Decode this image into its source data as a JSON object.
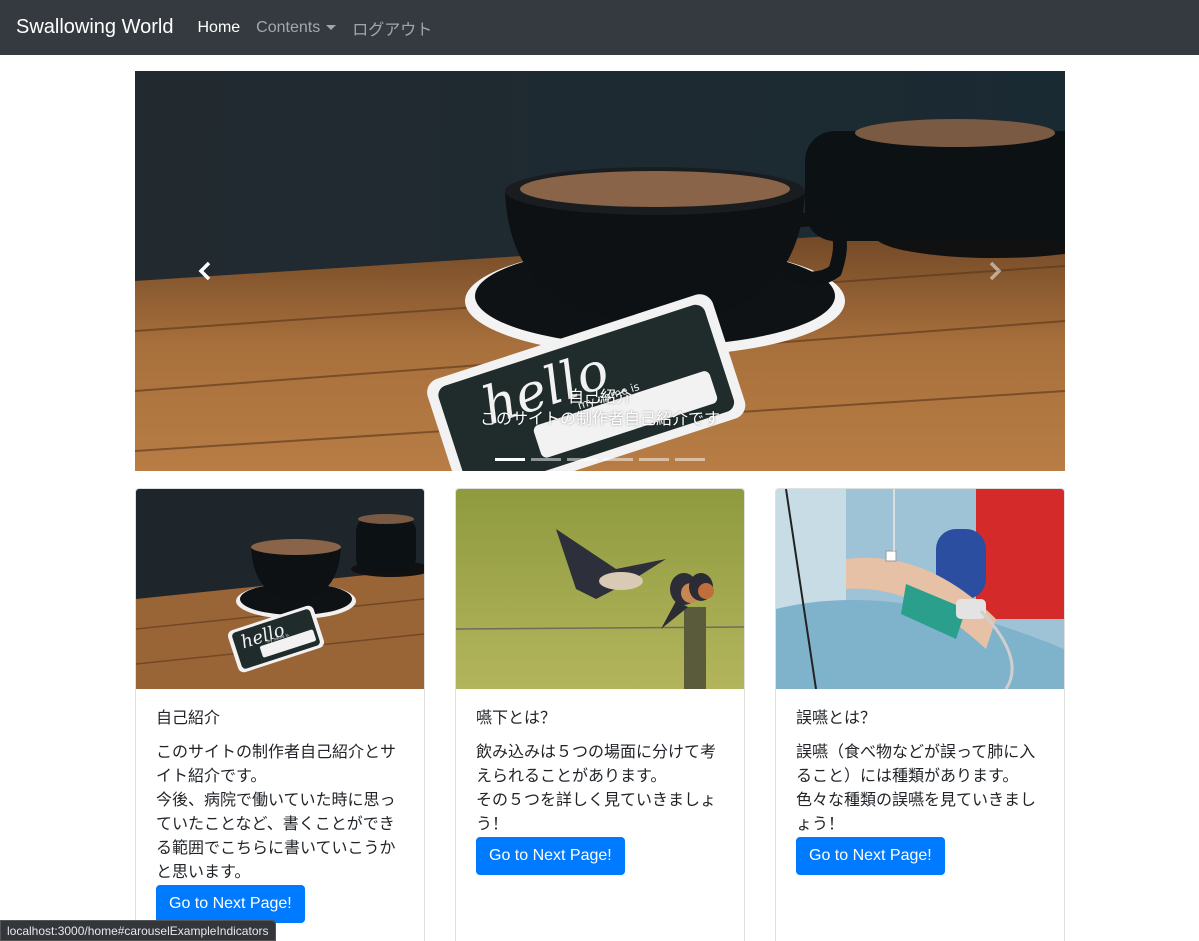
{
  "navbar": {
    "brand": "Swallowing World",
    "items": [
      {
        "label": "Home"
      },
      {
        "label": "Contents"
      },
      {
        "label": "ログアウト"
      }
    ]
  },
  "carousel": {
    "caption_title": "自己紹介",
    "caption_text": "このサイトの制作者自己紹介です",
    "indicator_count": 6,
    "active_index": 0,
    "sticker_text": "hello",
    "sticker_sub": "my name is"
  },
  "cards": [
    {
      "title": "自己紹介",
      "lines": [
        "このサイトの制作者自己紹介とサ",
        "イト紹介です。",
        "今後、病院で働いていた時に思っ",
        "ていたことなど、書くことができ",
        "る範囲でこちらに書いていこうか",
        "と思います。"
      ],
      "button": "Go to Next Page!",
      "sticker_text": "hello",
      "sticker_sub": "my name is"
    },
    {
      "title": "嚥下とは？",
      "lines": [
        "飲み込みは５つの場面に分けて考",
        "えられることがあります。",
        "その５つを詳しく見ていきましょ",
        "う！"
      ],
      "button": "Go to Next Page!"
    },
    {
      "title": "誤嚥とは？",
      "lines": [
        "誤嚥（食べ物などが誤って肺に入",
        "ること）には種類があります。",
        "色々な種類の誤嚥を見ていきまし",
        "ょう！"
      ],
      "button": "Go to Next Page!"
    }
  ],
  "status_bar": {
    "url": "localhost:3000/home#carouselExampleIndicators"
  },
  "colors": {
    "navbar_bg": "#343a40",
    "primary": "#007bff"
  }
}
